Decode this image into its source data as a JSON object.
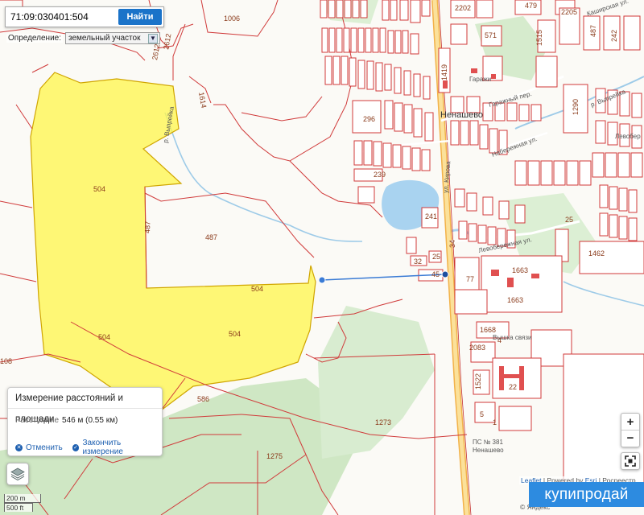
{
  "search": {
    "value": "71:09:030401:504",
    "button_label": "Найти"
  },
  "definition": {
    "label": "Определение:",
    "selected": "земельный участок"
  },
  "measure": {
    "title": "Измерение расстояний и площади",
    "distance_label": "Расстояние",
    "distance_value": "546 м (0.55 км)",
    "cancel_label": "Отменить",
    "finish_label": "Закончить измерение"
  },
  "zoom": {
    "in_label": "+",
    "out_label": "−"
  },
  "scale": {
    "metric": "200 m",
    "imperial": "500 ft"
  },
  "attribution": {
    "leaflet": "Leaflet",
    "sep": " | Powered by ",
    "esri": "Esri",
    "rest": " | Росреестр",
    "line2": "© Яндекс"
  },
  "watermark": "купипродай",
  "map": {
    "town": "Ненашево",
    "streets": {
      "street_kashirskaya": "Каширская ул.",
      "street_kirova": "ул. Кирова",
      "street_beregovaya": "Набережная ул.",
      "street_levoberezhnaya": "Левобережная ул.",
      "street_levober_short": "Левобер",
      "street_garazh": "Гаражи",
      "street_garazhny": "Гаражный пер.",
      "river_vyraika": "р. Выпрейка",
      "river_vyraika2": "р. Выпрейка"
    },
    "plots": {
      "p1006": "1006",
      "p2612": "2612",
      "p2612b": "2612",
      "p1614": "1614",
      "p504a": "504",
      "p504b": "504",
      "p504c": "504",
      "p504d": "504",
      "p487a": "487",
      "p487b": "487",
      "p586": "586",
      "p1273": "1273",
      "p1275": "1275",
      "p108": "108",
      "p2202": "2202",
      "p479": "479",
      "p2205": "2205",
      "p571": "571",
      "p1515": "1515",
      "p487c": "487",
      "p242": "242",
      "p1419": "1419",
      "p296": "296",
      "p1290": "1290",
      "p239": "239",
      "p241": "241",
      "p25": "25",
      "p34": "34",
      "p32": "32",
      "p25b": "25",
      "p45": "45",
      "p77": "77",
      "p1663a": "1663",
      "p1663b": "1663",
      "p1462": "1462",
      "p1668": "1668",
      "p2083": "2083",
      "p1522": "1522",
      "p22": "22",
      "p4": "4",
      "p5": "5",
      "p1": "1"
    },
    "poi": {
      "svyaz": "Вышка связи",
      "ps": "ПС № 381",
      "ps2": "Ненашево"
    }
  }
}
